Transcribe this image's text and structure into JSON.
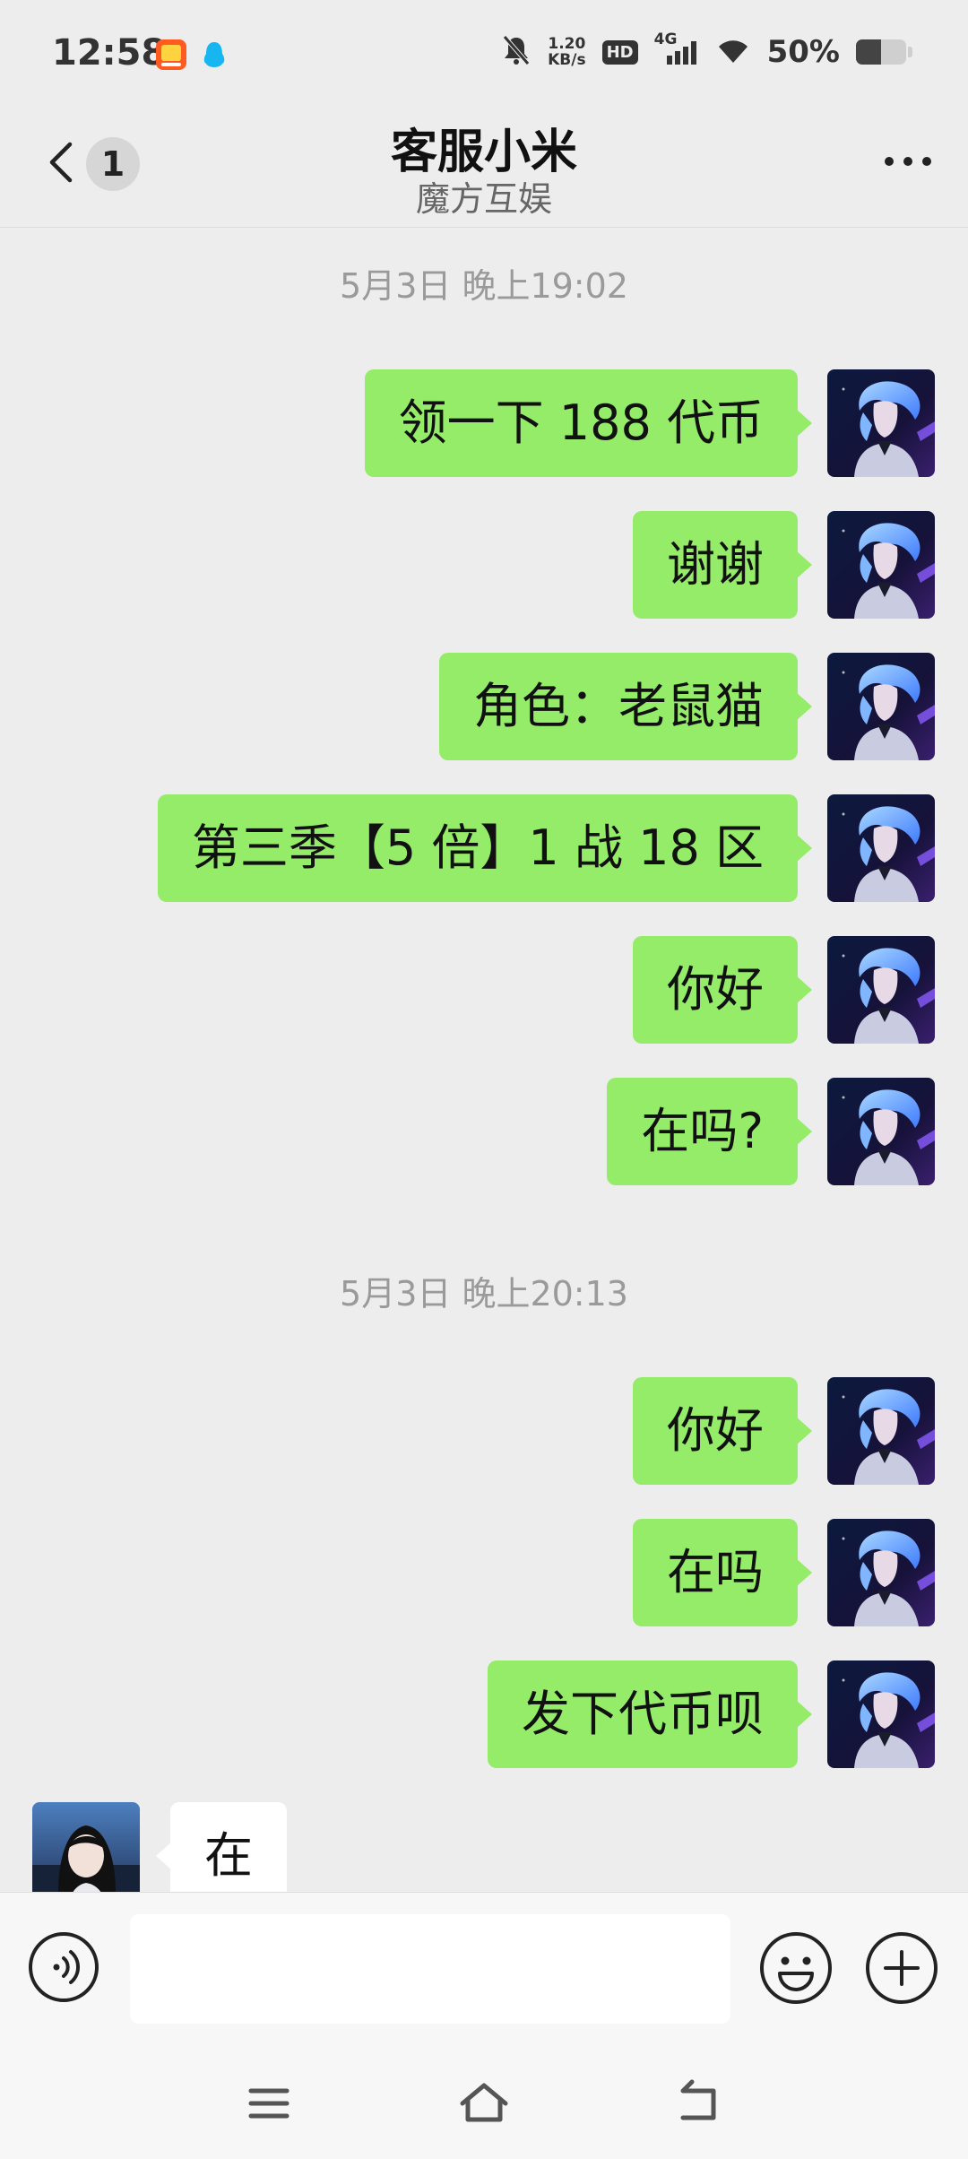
{
  "status_bar": {
    "time": "12:58",
    "speed_value": "1.20",
    "speed_unit": "KB/s",
    "hd": "HD",
    "network": "4G",
    "battery": "50%",
    "battery_level": 0.5
  },
  "header": {
    "back_count": "1",
    "title": "客服小米",
    "subtitle": "魔方互娱"
  },
  "timestamps": [
    "5月3日 晚上19:02",
    "5月3日 晚上20:13"
  ],
  "messages": [
    {
      "side": "sent",
      "text": "领一下 188 代币"
    },
    {
      "side": "sent",
      "text": "谢谢"
    },
    {
      "side": "sent",
      "text": "角色：老鼠猫"
    },
    {
      "side": "sent",
      "text": "第三季【5 倍】1 战 18 区"
    },
    {
      "side": "sent",
      "text": "你好"
    },
    {
      "side": "sent",
      "text": "在吗?"
    },
    {
      "side": "sent",
      "text": "你好"
    },
    {
      "side": "sent",
      "text": "在吗"
    },
    {
      "side": "sent",
      "text": "发下代币呗"
    },
    {
      "side": "received",
      "text": "在"
    }
  ],
  "input": {
    "value": ""
  },
  "colors": {
    "sent_bubble": "#95ec69",
    "received_bubble": "#ffffff",
    "background": "#ededed"
  },
  "icons": {
    "back": "chevron-left-icon",
    "more": "ellipsis-icon",
    "voice": "voice-icon",
    "emoji": "smiley-icon",
    "plus": "plus-icon",
    "nav_menu": "menu-icon",
    "nav_home": "home-icon",
    "nav_back": "back-icon"
  }
}
